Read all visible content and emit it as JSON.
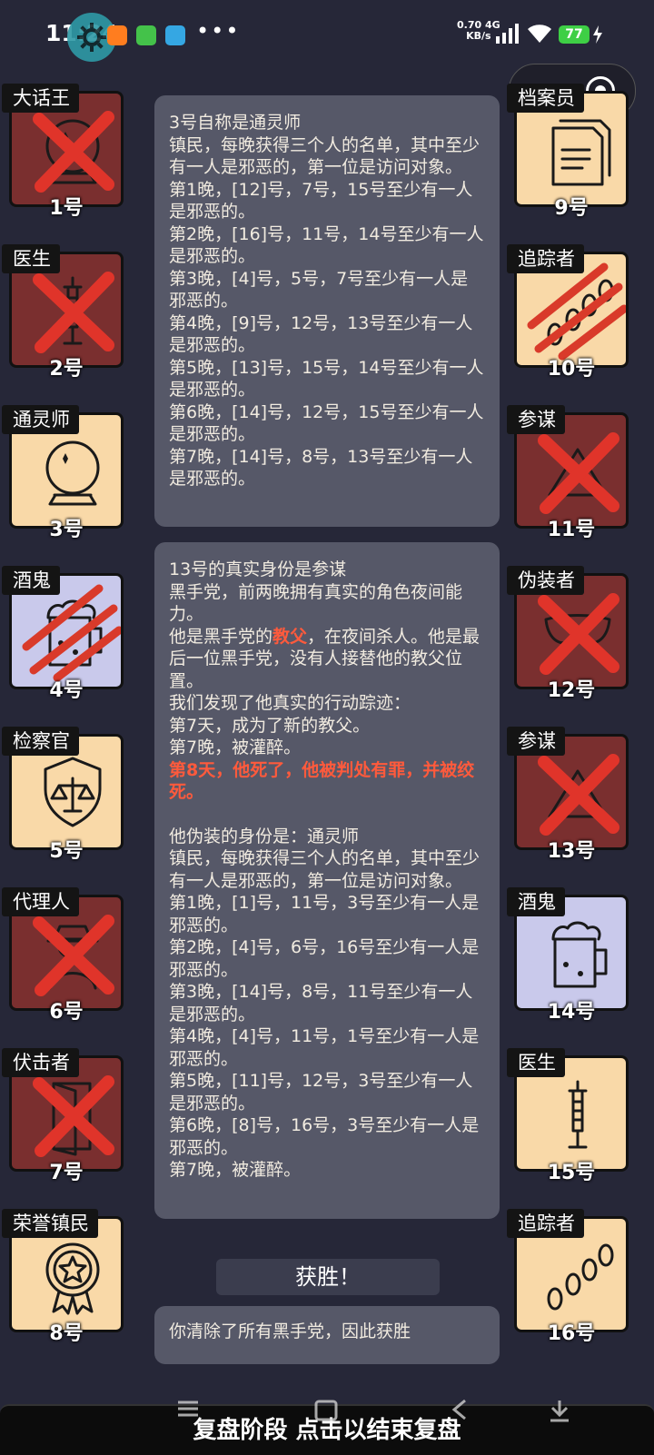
{
  "status_bar": {
    "time": "11:24",
    "network_speed": "0.70",
    "network_speed_unit": "KB/s",
    "network_type": "4G",
    "battery": "77"
  },
  "colors": {
    "town_card": "#f9d9a8",
    "drunk_card": "#c9c9eb",
    "evil_card": "#7a2f2f",
    "dead_cross": "#e0342a",
    "highlight_text": "#ff5a3c"
  },
  "players_left": [
    {
      "role": "大话王",
      "number": "1号",
      "icon": "crystal-ball-icon",
      "dead": true
    },
    {
      "role": "医生",
      "number": "2号",
      "icon": "syringe-icon",
      "dead": true
    },
    {
      "role": "通灵师",
      "number": "3号",
      "icon": "crystal-ball-icon",
      "dead": false
    },
    {
      "role": "酒鬼",
      "number": "4号",
      "icon": "beer-mug-icon",
      "dead": false,
      "scratched": true
    },
    {
      "role": "检察官",
      "number": "5号",
      "icon": "justice-scales-icon",
      "dead": false
    },
    {
      "role": "代理人",
      "number": "6号",
      "icon": "agent-icon",
      "dead": true
    },
    {
      "role": "伏击者",
      "number": "7号",
      "icon": "door-icon",
      "dead": true
    },
    {
      "role": "荣誉镇民",
      "number": "8号",
      "icon": "medal-icon",
      "dead": false
    }
  ],
  "players_right": [
    {
      "role": "档案员",
      "number": "9号",
      "icon": "documents-icon",
      "dead": false
    },
    {
      "role": "追踪者",
      "number": "10号",
      "icon": "footprints-icon",
      "dead": false,
      "scratched": true
    },
    {
      "role": "参谋",
      "number": "11号",
      "icon": "strategist-icon",
      "dead": true
    },
    {
      "role": "伪装者",
      "number": "12号",
      "icon": "mask-icon",
      "dead": true
    },
    {
      "role": "参谋",
      "number": "13号",
      "icon": "strategist-icon",
      "dead": true
    },
    {
      "role": "酒鬼",
      "number": "14号",
      "icon": "beer-mug-icon",
      "dead": false
    },
    {
      "role": "医生",
      "number": "15号",
      "icon": "syringe-icon",
      "dead": false
    },
    {
      "role": "追踪者",
      "number": "16号",
      "icon": "footprints-icon",
      "dead": false
    }
  ],
  "panel1": {
    "lines": [
      "3号自称是通灵师",
      "镇民，每晚获得三个人的名单，其中至少有一人是邪恶的，第一位是访问对象。",
      "第1晚，[12]号，7号，15号至少有一人是邪恶的。",
      "第2晚，[16]号，11号，14号至少有一人是邪恶的。",
      "第3晚，[4]号，5号，7号至少有一人是邪恶的。",
      "第4晚，[9]号，12号，13号至少有一人是邪恶的。",
      "第5晚，[13]号，15号，14号至少有一人是邪恶的。",
      "第6晚，[14]号，12号，15号至少有一人是邪恶的。",
      "第7晚，[14]号，8号，13号至少有一人是邪恶的。"
    ]
  },
  "panel2": {
    "intro": "13号的真实身份是参谋\n黑手党，前两晚拥有真实的角色夜间能力。",
    "godfather_prefix": "他是黑手党的",
    "godfather_word": "教父",
    "godfather_suffix": "，在夜间杀人。他是最后一位黑手党，没有人接替他的教父位置。",
    "trace": "我们发现了他真实的行动踪迹：\n第7天，成为了新的教父。\n第7晚，被灌醉。",
    "death": "第8天，他死了，他被判处有罪，并被绞死。",
    "disguise": "他伪装的身份是：通灵师\n镇民，每晚获得三个人的名单，其中至少有一人是邪恶的，第一位是访问对象。\n第1晚，[1]号，11号，3号至少有一人是邪恶的。\n第2晚，[4]号，6号，16号至少有一人是邪恶的。\n第3晚，[14]号，8号，11号至少有一人是邪恶的。\n第4晚，[4]号，11号，1号至少有一人是邪恶的。\n第5晚，[11]号，12号，3号至少有一人是邪恶的。\n第6晚，[8]号，16号，3号至少有一人是邪恶的。\n第7晚，被灌醉。"
  },
  "victory_label": "获胜！",
  "result_text": "你清除了所有黑手党，因此获胜",
  "bottom_bar": "复盘阶段 点击以结束复盘"
}
